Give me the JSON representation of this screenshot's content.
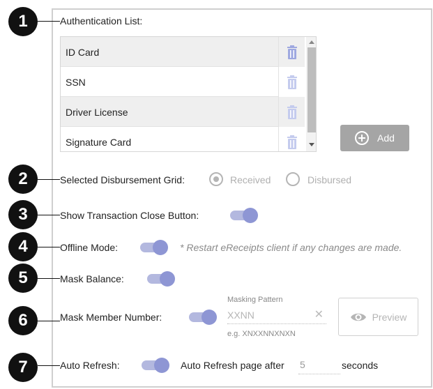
{
  "callouts": [
    "1",
    "2",
    "3",
    "4",
    "5",
    "6",
    "7"
  ],
  "auth": {
    "label": "Authentication List:",
    "items": [
      "ID Card",
      "SSN",
      "Driver License",
      "Signature Card"
    ],
    "add_label": "Add"
  },
  "disbursement": {
    "label": "Selected Disbursement Grid:",
    "options": [
      "Received",
      "Disbursed"
    ],
    "selected": "Received"
  },
  "close_button": {
    "label": "Show Transaction Close Button:",
    "on": true
  },
  "offline": {
    "label": "Offline Mode:",
    "on": true,
    "note": "* Restart eReceipts client if any changes are made."
  },
  "mask_balance": {
    "label": "Mask Balance:",
    "on": true
  },
  "mask_member": {
    "label": "Mask Member Number:",
    "on": true,
    "pattern_label": "Masking Pattern",
    "pattern_value": "XXNN",
    "clear_glyph": "✕",
    "example": "e.g. XNXXNNXNXN",
    "preview_label": "Preview"
  },
  "auto_refresh": {
    "label": "Auto Refresh:",
    "on": true,
    "after_label": "Auto Refresh page after",
    "value": "5",
    "unit": "seconds"
  },
  "colors": {
    "toggle_track": "#b3b8df",
    "toggle_knob": "#8e96d4",
    "button_gray": "#a5a5a5",
    "callout": "#111111"
  }
}
